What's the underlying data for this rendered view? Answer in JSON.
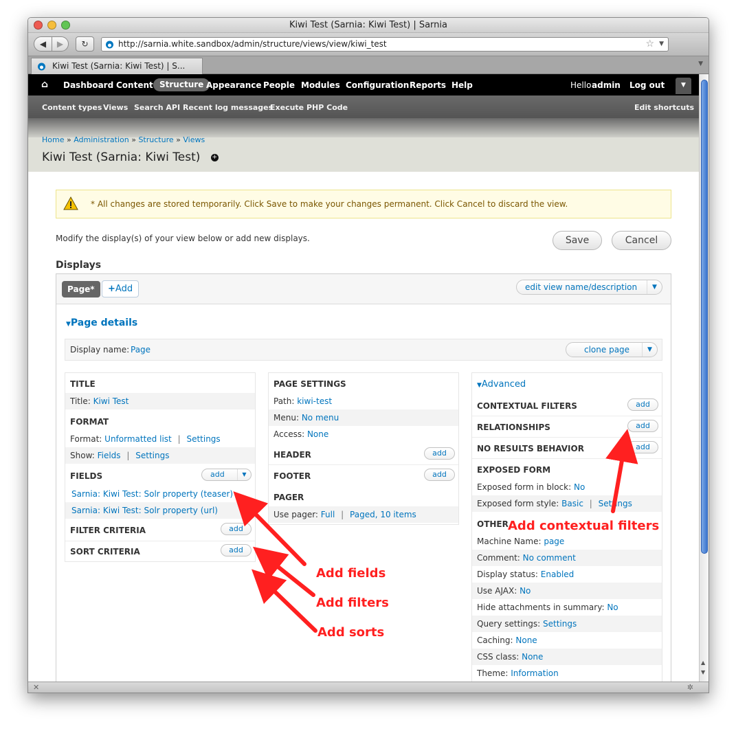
{
  "window": {
    "title": "Kiwi Test (Sarnia: Kiwi Test) | Sarnia"
  },
  "browser": {
    "url": "http://sarnia.white.sandbox/admin/structure/views/view/kiwi_test",
    "tab_label": "Kiwi Test (Sarnia: Kiwi Test) | S..."
  },
  "toolbar": {
    "items": [
      "Dashboard",
      "Content",
      "Structure",
      "Appearance",
      "People",
      "Modules",
      "Configuration",
      "Reports",
      "Help"
    ],
    "hello": "Hello",
    "user": "admin",
    "logout": "Log out"
  },
  "shortcuts": {
    "items": [
      "Content types",
      "Views",
      "Search API",
      "Recent log messages",
      "Execute PHP Code"
    ],
    "edit": "Edit shortcuts"
  },
  "breadcrumb": {
    "items": [
      "Home",
      "Administration",
      "Structure",
      "Views"
    ],
    "sep": "»"
  },
  "page_title": "Kiwi Test (Sarnia: Kiwi Test)",
  "warning": "* All changes are stored temporarily. Click Save to make your changes permanent. Click Cancel to discard the view.",
  "intro": "Modify the display(s) of your view below or add new displays.",
  "buttons": {
    "save": "Save",
    "cancel": "Cancel"
  },
  "displays": {
    "heading": "Displays",
    "tab_page": "Page*",
    "tab_add": "Add",
    "edit_view": "edit view name/description",
    "details": "Page details",
    "display_name_label": "Display name:",
    "display_name_value": "Page",
    "clone": "clone page"
  },
  "col1": {
    "title_h": "TITLE",
    "title_label": "Title:",
    "title_value": "Kiwi Test",
    "format_h": "FORMAT",
    "format_label": "Format:",
    "format_value": "Unformatted list",
    "format_settings": "Settings",
    "show_label": "Show:",
    "show_value": "Fields",
    "show_settings": "Settings",
    "fields_h": "FIELDS",
    "field1": "Sarnia: Kiwi Test: Solr property (teaser)",
    "field2": "Sarnia: Kiwi Test: Solr property (url)",
    "filter_h": "FILTER CRITERIA",
    "sort_h": "SORT CRITERIA",
    "add": "add",
    "pipe": "|"
  },
  "col2": {
    "page_settings_h": "PAGE SETTINGS",
    "path_label": "Path:",
    "path_value": "kiwi-test",
    "menu_label": "Menu:",
    "menu_value": "No menu",
    "access_label": "Access:",
    "access_value": "None",
    "header_h": "HEADER",
    "footer_h": "FOOTER",
    "pager_h": "PAGER",
    "pager_label": "Use pager:",
    "pager_value": "Full",
    "pager_value2": "Paged, 10 items"
  },
  "col3": {
    "advanced": "Advanced",
    "contextual_h": "CONTEXTUAL FILTERS",
    "relationships_h": "RELATIONSHIPS",
    "noresults_h": "NO RESULTS BEHAVIOR",
    "exposed_h": "EXPOSED FORM",
    "exposed_block_label": "Exposed form in block:",
    "exposed_block_value": "No",
    "exposed_style_label": "Exposed form style:",
    "exposed_style_value": "Basic",
    "exposed_style_settings": "Settings",
    "other_h": "OTHER",
    "rows": [
      {
        "label": "Machine Name:",
        "value": "page"
      },
      {
        "label": "Comment:",
        "value": "No comment"
      },
      {
        "label": "Display status:",
        "value": "Enabled"
      },
      {
        "label": "Use AJAX:",
        "value": "No"
      },
      {
        "label": "Hide attachments in summary:",
        "value": "No"
      },
      {
        "label": "Query settings:",
        "value": "Settings"
      },
      {
        "label": "Caching:",
        "value": "None"
      },
      {
        "label": "CSS class:",
        "value": "None"
      },
      {
        "label": "Theme:",
        "value": "Information"
      }
    ]
  },
  "annotations": {
    "fields": "Add fields",
    "filters": "Add filters",
    "sorts": "Add sorts",
    "contextual": "Add contextual filters"
  },
  "colors": {
    "link": "#0074bd",
    "annotation": "#ff2020",
    "toolbar": "#000000",
    "warning_bg": "#fffce5"
  }
}
